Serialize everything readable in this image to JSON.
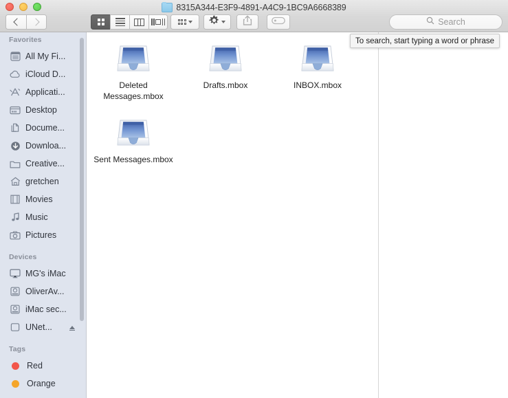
{
  "window": {
    "title": "8315A344-E3F9-4891-A4C9-1BC9A6668389",
    "traffic_lights": {
      "close": "close-button",
      "minimize": "minimize-button",
      "maximize": "maximize-button"
    }
  },
  "toolbar": {
    "back_label": "Back",
    "forward_label": "Forward",
    "view_modes": [
      {
        "name": "icon-view",
        "label": "Icon View",
        "active": true
      },
      {
        "name": "list-view",
        "label": "List View",
        "active": false
      },
      {
        "name": "column-view",
        "label": "Column View",
        "active": false
      },
      {
        "name": "cover-flow-view",
        "label": "Cover Flow View",
        "active": false
      }
    ],
    "arrange_label": "Arrange",
    "action_label": "Action",
    "share_label": "Share",
    "tag_label": "Edit Tags"
  },
  "search": {
    "placeholder": "Search",
    "value": "",
    "tooltip": "To search, start typing a word or phrase"
  },
  "sidebar": {
    "sections": [
      {
        "title": "Favorites",
        "items": [
          {
            "label": "All My Fi...",
            "icon": "all-my-files-icon"
          },
          {
            "label": "iCloud D...",
            "icon": "icloud-drive-icon"
          },
          {
            "label": "Applicati...",
            "icon": "applications-icon"
          },
          {
            "label": "Desktop",
            "icon": "desktop-icon"
          },
          {
            "label": "Docume...",
            "icon": "documents-icon"
          },
          {
            "label": "Downloa...",
            "icon": "downloads-icon"
          },
          {
            "label": "Creative...",
            "icon": "folder-icon"
          },
          {
            "label": "gretchen",
            "icon": "home-icon"
          },
          {
            "label": "Movies",
            "icon": "movies-icon"
          },
          {
            "label": "Music",
            "icon": "music-icon"
          },
          {
            "label": "Pictures",
            "icon": "pictures-icon"
          }
        ]
      },
      {
        "title": "Devices",
        "items": [
          {
            "label": "MG's iMac",
            "icon": "imac-icon"
          },
          {
            "label": "OliverAv...",
            "icon": "hard-disk-icon"
          },
          {
            "label": "iMac sec...",
            "icon": "hard-disk-icon"
          },
          {
            "label": "UNet...",
            "icon": "external-disk-icon",
            "eject": true
          }
        ]
      },
      {
        "title": "Tags",
        "items": [
          {
            "label": "Red",
            "icon": "tag-dot",
            "color": "#f2564b"
          },
          {
            "label": "Orange",
            "icon": "tag-dot",
            "color": "#f4a52a"
          }
        ]
      }
    ]
  },
  "content": {
    "files": [
      {
        "name": "Deleted Messages.mbox",
        "icon": "mailbox-icon"
      },
      {
        "name": "Drafts.mbox",
        "icon": "mailbox-icon"
      },
      {
        "name": "INBOX.mbox",
        "icon": "mailbox-icon"
      },
      {
        "name": "Sent Messages.mbox",
        "icon": "mailbox-icon"
      }
    ]
  },
  "colors": {
    "sidebar_bg": "#dfe4ee",
    "titlebar_bg": "#d8d8d8",
    "content_bg": "#ffffff",
    "tag_red": "#f2564b",
    "tag_orange": "#f4a52a",
    "mbox_blue": "#5b7fc4"
  }
}
